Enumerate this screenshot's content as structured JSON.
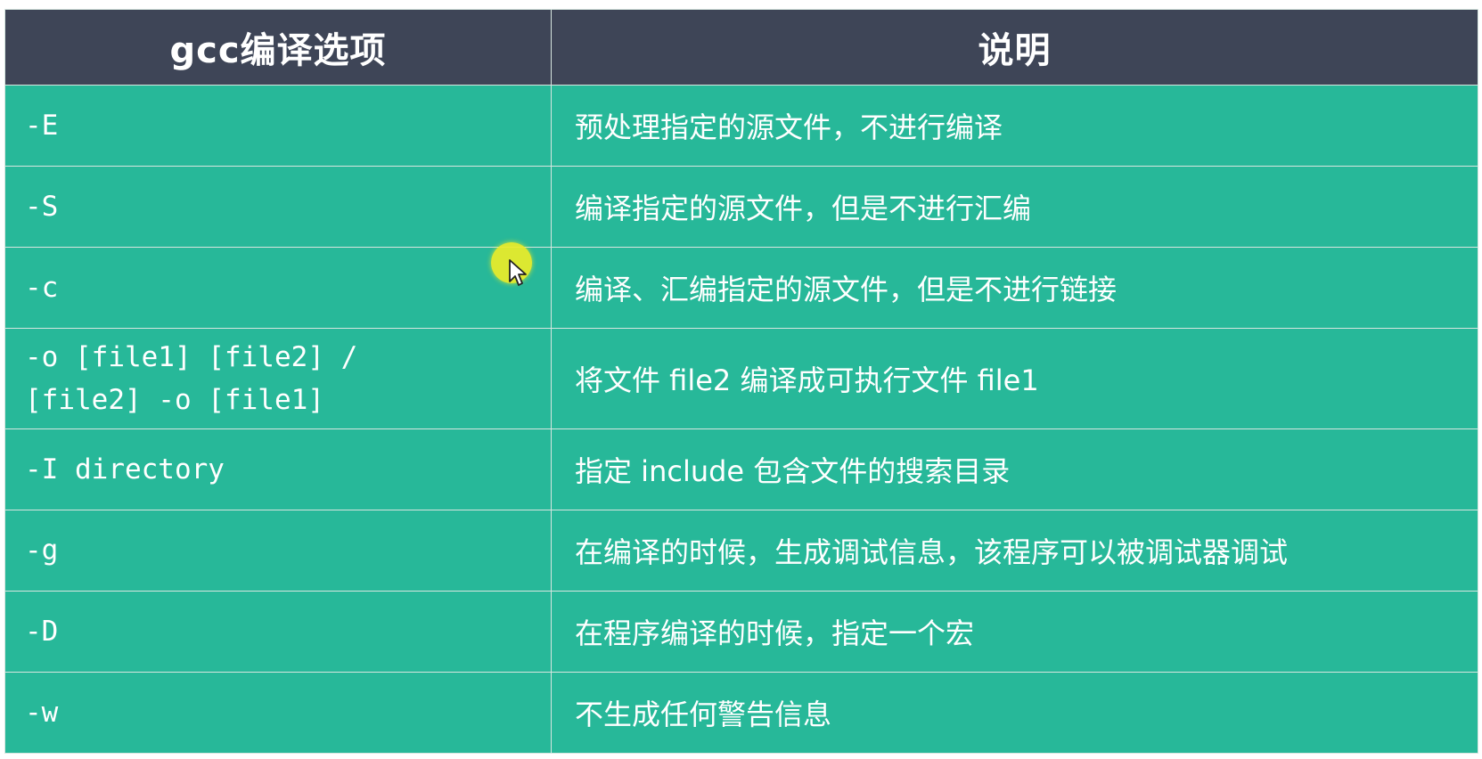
{
  "table": {
    "header": {
      "option": "gcc编译选项",
      "description": "说明"
    },
    "rows": [
      {
        "option": "-E",
        "description": "预处理指定的源文件，不进行编译"
      },
      {
        "option": "-S",
        "description": "编译指定的源文件，但是不进行汇编"
      },
      {
        "option": "-c",
        "description": "编译、汇编指定的源文件，但是不进行链接"
      },
      {
        "option": "-o [file1] [file2] /\n[file2] -o [file1]",
        "description": "将文件 file2 编译成可执行文件 file1"
      },
      {
        "option": "-I directory",
        "description": "指定 include 包含文件的搜索目录"
      },
      {
        "option": "-g",
        "description": "在编译的时候，生成调试信息，该程序可以被调试器调试"
      },
      {
        "option": "-D",
        "description": "在程序编译的时候，指定一个宏"
      },
      {
        "option": "-w",
        "description": "不生成任何警告信息"
      }
    ]
  },
  "colors": {
    "header_bg": "#3e4557",
    "row_bg": "#27b899",
    "text": "#ffffff",
    "cursor_highlight": "#ecec28"
  },
  "icons": {
    "cursor": "mouse-pointer-icon"
  }
}
